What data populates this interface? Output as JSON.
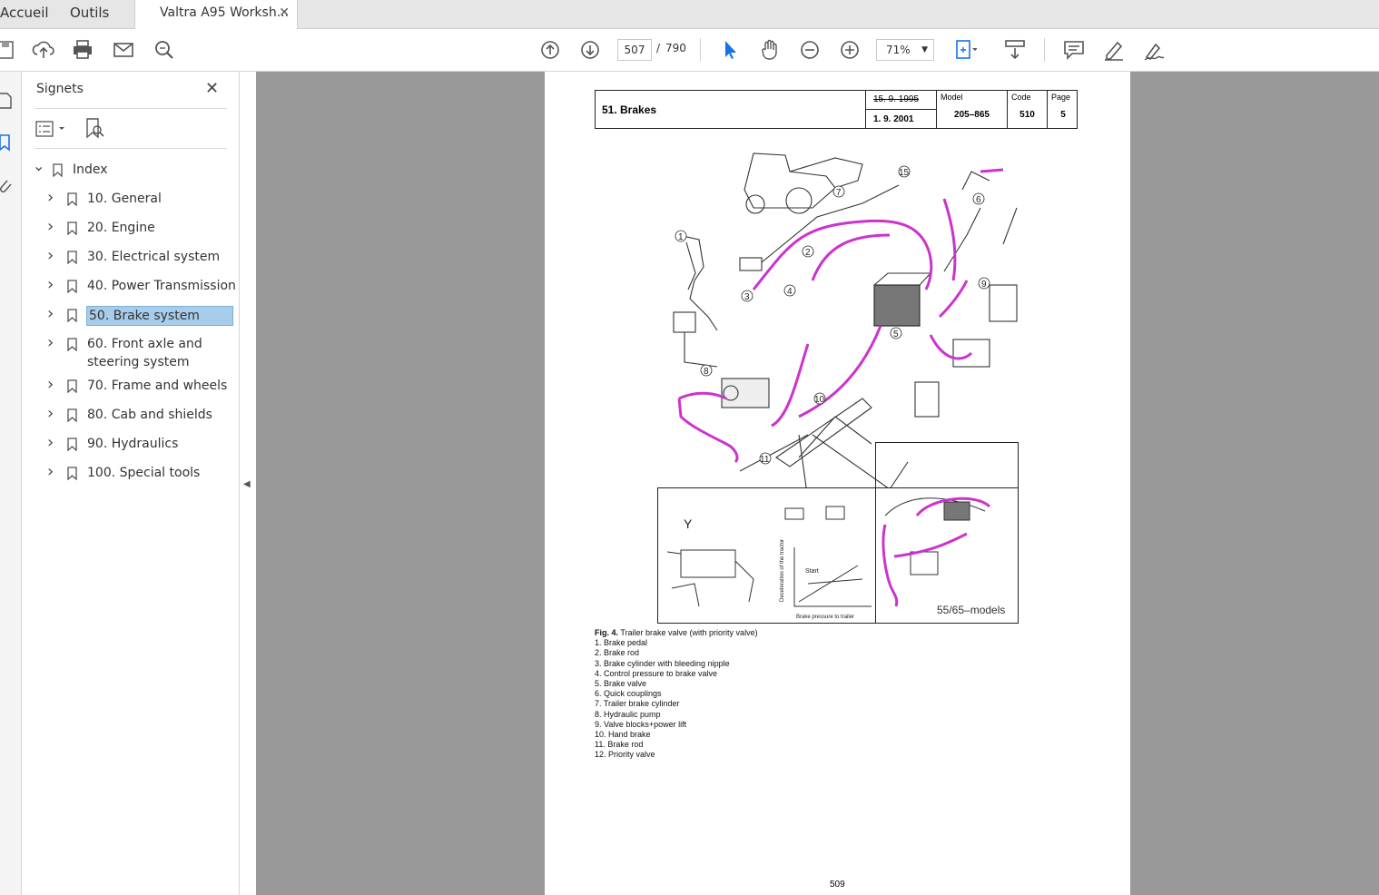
{
  "tabs": [
    {
      "label": "Accueil"
    },
    {
      "label": "Outils"
    },
    {
      "label": "Valtra A95 Worksh..."
    }
  ],
  "toolbar": {
    "current_page": "507",
    "page_separator": "/",
    "total_pages": "790",
    "zoom": "71%"
  },
  "panel": {
    "title": "Signets",
    "bookmarks": [
      {
        "label": "Index"
      },
      {
        "label": "10. General"
      },
      {
        "label": "20. Engine"
      },
      {
        "label": "30. Electrical system"
      },
      {
        "label": "40. Power Transmission"
      },
      {
        "label": "50. Brake system"
      },
      {
        "label": "60. Front axle and"
      },
      {
        "label": "steering system"
      },
      {
        "label": "70. Frame and wheels"
      },
      {
        "label": "80. Cab and shields"
      },
      {
        "label": "90. Hydraulics"
      },
      {
        "label": "100. Special tools"
      }
    ],
    "selected_index": 5
  },
  "document": {
    "header": {
      "title": "51. Brakes",
      "date_old": "15. 9. 1995",
      "date_new": "1. 9. 2001",
      "model_label": "Model",
      "model_value": "205–865",
      "code_label": "Code",
      "code_value": "510",
      "page_label": "Page",
      "page_value": "5"
    },
    "figure": {
      "models_label": "55/65–models",
      "inset_y_label": "Y",
      "graph_start": "Start",
      "graph_xlabel": "Brake pressure to trailer",
      "graph_ylabel": "Deceleration of the tractor"
    },
    "caption": {
      "fig_label": "Fig. 4.",
      "fig_text": "Trailer brake valve (with priority valve)",
      "items": [
        "1. Brake pedal",
        "2. Brake rod",
        "3. Brake cylinder with bleeding nipple",
        "4. Control pressure to brake valve",
        "5. Brake valve",
        "6. Quick couplings",
        "7. Trailer brake cylinder",
        "8. Hydraulic pump",
        "9. Valve blocks+power lift",
        "10. Hand brake",
        "11. Brake rod",
        "12. Priority valve"
      ]
    },
    "page_number": "509"
  },
  "colors": {
    "selection": "#a8cdea",
    "hydraulic_line": "#cc33cc",
    "viewer_bg": "#999999"
  }
}
